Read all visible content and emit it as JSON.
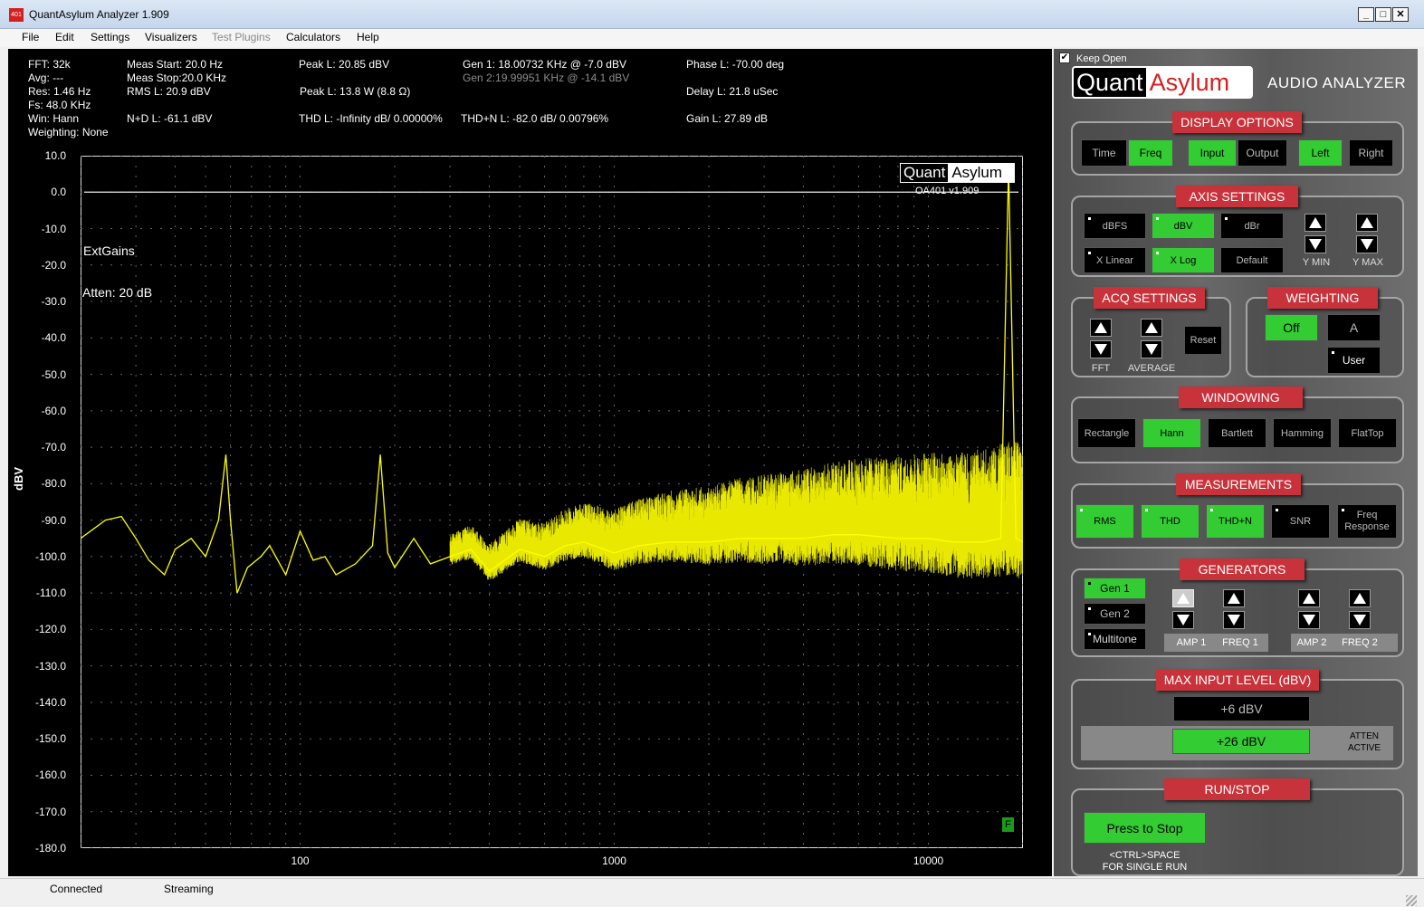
{
  "window": {
    "title": "QuantAsylum Analyzer 1.909",
    "icon_text": "401",
    "min": "_",
    "max": "□",
    "close": "✕"
  },
  "menu": [
    "File",
    "Edit",
    "Settings",
    "Visualizers",
    "Test Plugins",
    "Calculators",
    "Help"
  ],
  "readouts": {
    "fft": "FFT: 32k",
    "avg": "Avg: ---",
    "res": "Res: 1.46 Hz",
    "fs": "Fs: 48.0 KHz",
    "win": "Win: Hann",
    "weighting": "Weighting: None",
    "meas_start": "Meas Start: 20.0 Hz",
    "meas_stop": "Meas Stop:20.0 KHz",
    "rms": "RMS L: 20.9 dBV",
    "nd": "N+D L: -61.1 dBV",
    "peak1": "Peak L: 20.85 dBV",
    "peak2": "Peak L: 13.8 W (8.8 Ω)",
    "thd": "THD L: -Infinity dB/ 0.00000%",
    "gen1": "Gen 1: 18.00732 KHz @ -7.0  dBV",
    "gen2": "Gen 2:19.99951 KHz @ -14.1  dBV",
    "thdn": "THD+N L: -82.0 dB/ 0.00796%",
    "phase": "Phase L: -70.00 deg",
    "delay": "Delay L: 21.8 uSec",
    "gain": "Gain L: 27.89 dB"
  },
  "plot_labels": {
    "extgains": "ExtGains",
    "atten": "Atten: 20 dB",
    "logo_quant": "Quant",
    "logo_asylum": "Asylum",
    "version": "OA401 v1.909",
    "marker": "F"
  },
  "chart_data": {
    "type": "line",
    "ylabel": "dBV",
    "xscale": "log",
    "xlim": [
      20,
      20000
    ],
    "ylim": [
      -180,
      10
    ],
    "yticks": [
      "10.0",
      "0.0",
      "-10.0",
      "-20.0",
      "-30.0",
      "-40.0",
      "-50.0",
      "-60.0",
      "-70.0",
      "-80.0",
      "-90.0",
      "-100.0",
      "-110.0",
      "-120.0",
      "-130.0",
      "-140.0",
      "-150.0",
      "-160.0",
      "-170.0",
      "-180.0"
    ],
    "xticks": [
      "100",
      "1000",
      "10000"
    ],
    "xtick_values": [
      100,
      1000,
      10000
    ],
    "reference_line_db": 0,
    "series": [
      {
        "color": "#ffff00",
        "x": [
          20,
          24,
          27,
          30,
          33,
          37,
          40,
          45,
          50,
          55,
          58,
          60,
          63,
          68,
          75,
          80,
          90,
          100,
          110,
          120,
          130,
          150,
          170,
          180,
          190,
          200,
          230,
          260,
          300,
          350,
          400,
          500,
          600,
          700,
          800,
          1000,
          1200,
          1500,
          2000,
          2500,
          3000,
          4000,
          5000,
          6000,
          8000,
          10000,
          12000,
          15000,
          17000,
          18000,
          19000,
          20000
        ],
        "y": [
          -95,
          -90,
          -89,
          -95,
          -101,
          -105,
          -98,
          -95,
          -100,
          -90,
          -72,
          -90,
          -110,
          -103,
          -100,
          -97,
          -105,
          -93,
          -101,
          -100,
          -105,
          -102,
          -97,
          -72,
          -99,
          -103,
          -95,
          -102,
          -100,
          -98,
          -104,
          -98,
          -100,
          -97,
          -96,
          -99,
          -97,
          -96,
          -96,
          -95,
          -95,
          -95,
          -94,
          -94,
          -95,
          -95,
          -96,
          -96,
          -95,
          7,
          -95,
          -96
        ]
      }
    ],
    "grid": true
  },
  "status": {
    "left": "Connected",
    "right": "Streaming"
  },
  "panel": {
    "keep_open": "Keep Open",
    "logo_quant": "Quant",
    "logo_asylum": "Asylum",
    "subtitle": "AUDIO ANALYZER",
    "display": {
      "title": "DISPLAY OPTIONS",
      "buttons": [
        "Time",
        "Freq",
        "Input",
        "Output",
        "Left",
        "Right"
      ]
    },
    "axis": {
      "title": "AXIS SETTINGS",
      "buttons": [
        "dBFS",
        "dBV",
        "dBr",
        "X Linear",
        "X Log",
        "Default"
      ],
      "ymin": "Y MIN",
      "ymax": "Y MAX"
    },
    "acq": {
      "title": "ACQ SETTINGS",
      "fft": "FFT",
      "average": "AVERAGE",
      "reset": "Reset"
    },
    "weighting": {
      "title": "WEIGHTING",
      "off": "Off",
      "a": "A",
      "user": "User"
    },
    "windowing": {
      "title": "WINDOWING",
      "buttons": [
        "Rectangle",
        "Hann",
        "Bartlett",
        "Hamming",
        "FlatTop"
      ]
    },
    "measurements": {
      "title": "MEASUREMENTS",
      "buttons": [
        "RMS",
        "THD",
        "THD+N",
        "SNR",
        "Freq Response"
      ]
    },
    "generators": {
      "title": "GENERATORS",
      "gen1": "Gen 1",
      "gen2": "Gen 2",
      "multitone": "Multitone",
      "amp1": "AMP 1",
      "freq1": "FREQ 1",
      "amp2": "AMP 2",
      "freq2": "FREQ 2"
    },
    "maxinput": {
      "title": "MAX INPUT LEVEL (dBV)",
      "level1": "+6 dBV",
      "level2": "+26 dBV",
      "atten1": "ATTEN",
      "atten2": "ACTIVE"
    },
    "runstop": {
      "title": "RUN/STOP",
      "button": "Press to Stop",
      "hint1": "<CTRL>SPACE",
      "hint2": "FOR SINGLE RUN"
    }
  }
}
